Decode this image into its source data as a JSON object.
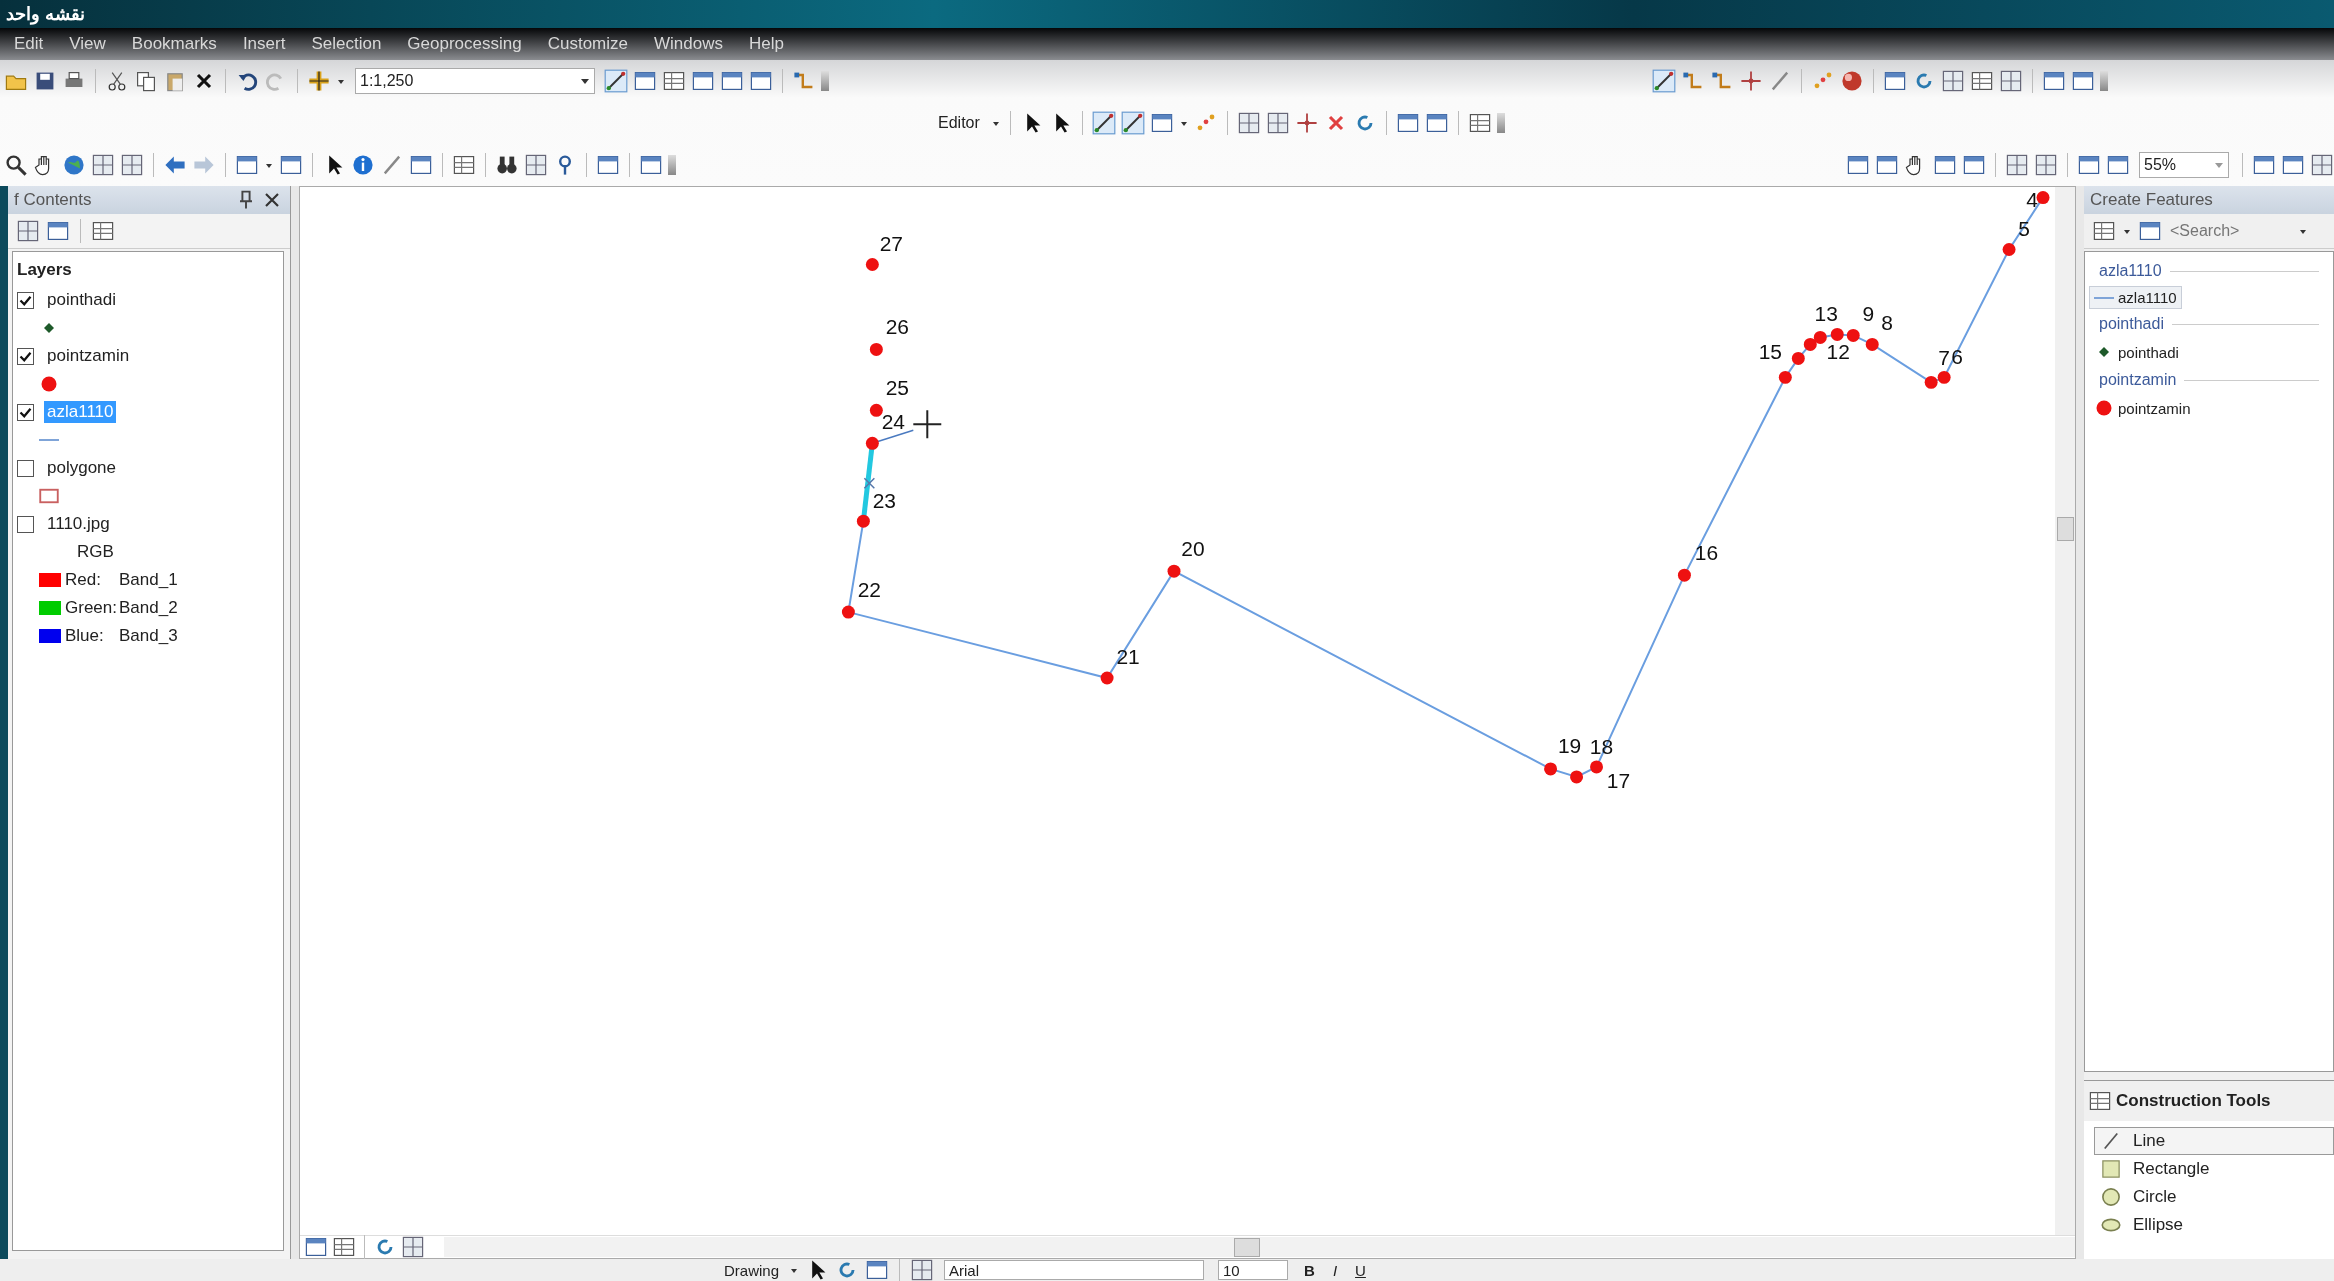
{
  "window": {
    "title": "نقشه واحد"
  },
  "menu": [
    {
      "label": "Edit"
    },
    {
      "label": "View"
    },
    {
      "label": "Bookmarks"
    },
    {
      "label": "Insert"
    },
    {
      "label": "Selection"
    },
    {
      "label": "Geoprocessing"
    },
    {
      "label": "Customize"
    },
    {
      "label": "Windows"
    },
    {
      "label": "Help"
    }
  ],
  "toolbar": {
    "scale": "1:1,250",
    "editor": "Editor",
    "zoom": "55%"
  },
  "toc": {
    "title": "f Contents",
    "root": "Layers",
    "layers": [
      {
        "name": "pointhadi",
        "checked": true,
        "selected": false,
        "kind": "point-diamond"
      },
      {
        "name": "pointzamin",
        "checked": true,
        "selected": false,
        "kind": "point-circle"
      },
      {
        "name": "azla1110",
        "checked": true,
        "selected": true,
        "kind": "line"
      },
      {
        "name": "polygone",
        "checked": false,
        "selected": false,
        "kind": "polygon"
      },
      {
        "name": "1110.jpg",
        "checked": false,
        "selected": false,
        "kind": "raster",
        "legend_title": "RGB",
        "bands": [
          {
            "label": "Red:",
            "value": "Band_1",
            "color": "#ff0000"
          },
          {
            "label": "Green:",
            "value": "Band_2",
            "color": "#00cc00"
          },
          {
            "label": "Blue:",
            "value": "Band_3",
            "color": "#0000ee"
          }
        ]
      }
    ]
  },
  "map": {
    "labels": [
      "27",
      "26",
      "25",
      "24",
      "23",
      "22",
      "21",
      "20",
      "19",
      "18",
      "17",
      "16",
      "15",
      "13",
      "12",
      "9",
      "8",
      "7",
      "6",
      "5",
      "4"
    ]
  },
  "create_features": {
    "title": "Create Features",
    "search": {
      "placeholder": "<Search>"
    },
    "groups": [
      {
        "name": "azla1110",
        "templates": [
          {
            "name": "azla1110",
            "kind": "line",
            "selected": true
          }
        ]
      },
      {
        "name": "pointhadi",
        "templates": [
          {
            "name": "pointhadi",
            "kind": "point-diamond",
            "selected": false
          }
        ]
      },
      {
        "name": "pointzamin",
        "templates": [
          {
            "name": "pointzamin",
            "kind": "point-circle",
            "selected": false
          }
        ]
      }
    ]
  },
  "construction_tools": {
    "title": "Construction Tools",
    "tools": [
      {
        "name": "Line",
        "kind": "line",
        "selected": true
      },
      {
        "name": "Rectangle",
        "kind": "rectangle",
        "selected": false
      },
      {
        "name": "Circle",
        "kind": "circle",
        "selected": false
      },
      {
        "name": "Ellipse",
        "kind": "ellipse",
        "selected": false
      }
    ]
  },
  "drawing_toolbar": {
    "label": "Drawing",
    "font": "Arial",
    "size": "10",
    "styles": [
      "B",
      "I",
      "U"
    ]
  }
}
